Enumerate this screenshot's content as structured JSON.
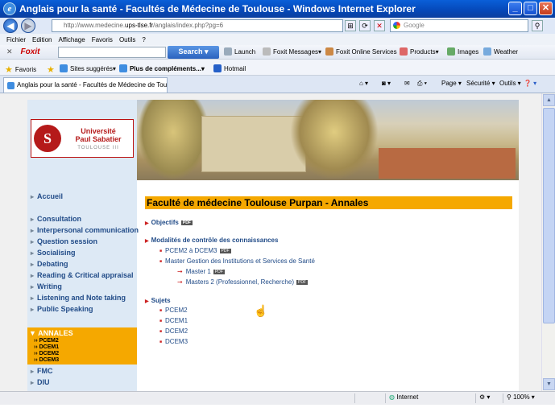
{
  "window": {
    "title": "Anglais pour la santé - Facultés de Médecine de Toulouse - Windows Internet Explorer"
  },
  "address": {
    "url_prefix": "http://www.medecine.",
    "url_domain": "ups-tlse.fr",
    "url_suffix": "/anglais/index.php?pg=6",
    "search_placeholder": "Google"
  },
  "menu": [
    "Fichier",
    "Edition",
    "Affichage",
    "Favoris",
    "Outils",
    "?"
  ],
  "foxit": {
    "brand": "Foxit",
    "search_label": "Search",
    "launch": "Launch",
    "messages": "Foxit Messages",
    "services": "Foxit Online Services",
    "products": "Products",
    "images": "Images",
    "weather": "Weather"
  },
  "favbar": {
    "favoris": "Favoris",
    "sites": "Sites suggérés",
    "plus": "Plus de compléments...",
    "hotmail": "Hotmail"
  },
  "tab": {
    "label": "Anglais pour la santé - Facultés de Médecine de Toulo..."
  },
  "tools": {
    "page": "Page",
    "securite": "Sécurité",
    "outils": "Outils"
  },
  "logo": {
    "line1": "Université",
    "line2": "Paul Sabatier",
    "line3": "TOULOUSE III"
  },
  "nav": {
    "accueil": "Accueil",
    "items": [
      "Consultation",
      "Interpersonal communication",
      "Question session",
      "Socialising",
      "Debating",
      "Reading & Critical appraisal",
      "Writing",
      "Listening and Note taking",
      "Public Speaking"
    ],
    "annales": "ANNALES",
    "annales_sub": [
      "PCEM2",
      "DCEM1",
      "DCEM2",
      "DCEM3"
    ],
    "fmc": "FMC",
    "diu": "DIU"
  },
  "main": {
    "title": "Faculté de médecine Toulouse Purpan - Annales",
    "objectifs": "Objectifs",
    "modalites": "Modalités de contrôle des connaissances",
    "mod_items": [
      "PCEM2 à DCEM3",
      "Master Gestion des Institutions et Services de Santé"
    ],
    "masters": [
      "Master 1",
      "Masters 2 (Professionnel, Recherche)"
    ],
    "sujets": "Sujets",
    "sujets_items": [
      "PCEM2",
      "DCEM1",
      "DCEM2",
      "DCEM3"
    ],
    "pdf": "PDF"
  },
  "status": {
    "zone": "Internet",
    "zoom": "100%"
  }
}
